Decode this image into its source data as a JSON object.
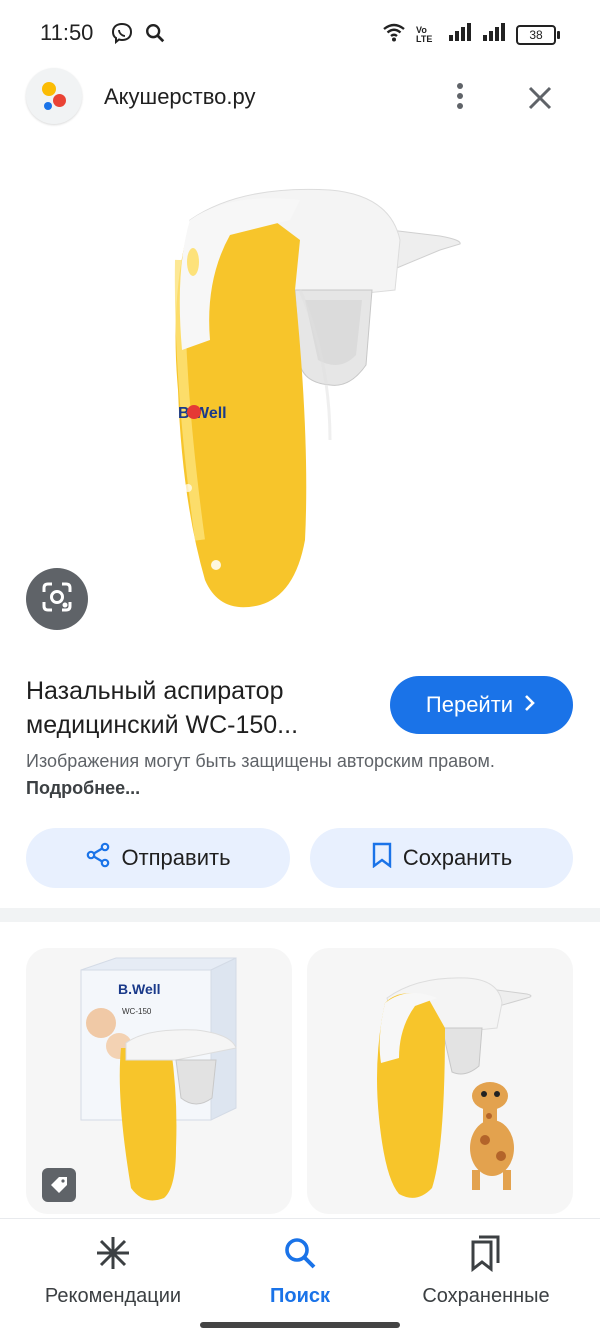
{
  "status_bar": {
    "time": "11:50",
    "battery": "38",
    "icons_left": [
      "viber-icon",
      "search-icon"
    ],
    "icons_right": [
      "wifi-icon",
      "volte-icon",
      "signal-icon",
      "signal-icon",
      "battery-icon"
    ],
    "volte_text": "Vo LTE"
  },
  "header": {
    "site_name": "Акушерство.ру",
    "more_icon": "more-vert-icon",
    "close_icon": "close-icon"
  },
  "product": {
    "title": "Назальный аспиратор медицинский WC-150...",
    "goto_label": "Перейти",
    "copyright_text": "Изображения могут быть защищены авторским правом.",
    "more_link": "Подробнее...",
    "brand_mark": "B.Well"
  },
  "actions": {
    "share_label": "Отправить",
    "save_label": "Сохранить"
  },
  "thumbnails": [
    {
      "box_brand": "B.Well",
      "box_model": "WC-150"
    },
    {
      "box_brand": "",
      "box_model": ""
    }
  ],
  "bottom_nav": {
    "items": [
      {
        "label": "Рекомендации",
        "icon": "asterisk-icon",
        "active": false
      },
      {
        "label": "Поиск",
        "icon": "search-icon",
        "active": true
      },
      {
        "label": "Сохраненные",
        "icon": "bookmarks-icon",
        "active": false
      }
    ]
  },
  "colors": {
    "accent": "#1a73e8",
    "button_tint": "#e8f0fe",
    "device_yellow": "#f7c52b"
  }
}
